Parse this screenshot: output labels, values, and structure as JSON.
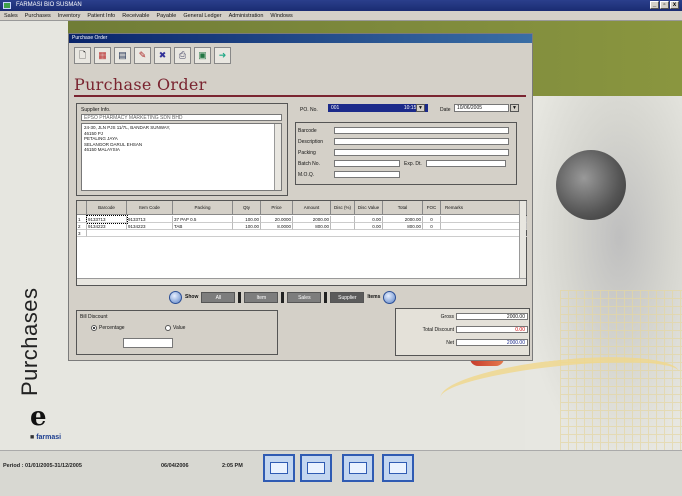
{
  "app": {
    "title": "FARMASI BIO SUSMAN"
  },
  "window_controls": [
    "_",
    "▫",
    "x"
  ],
  "menu": [
    "Sales",
    "Purchases",
    "Inventory",
    "Patient Info",
    "Receivable",
    "Payable",
    "General Ledger",
    "Administration",
    "Windows"
  ],
  "window": {
    "title": "Purchase Order"
  },
  "toolbar": [
    "new-icon",
    "open-icon",
    "save-icon",
    "edit-icon",
    "delete-icon",
    "print-icon",
    "preview-icon",
    "exit-icon"
  ],
  "page_title": "Purchase Order",
  "supplier": {
    "label": "Supplier Info.",
    "selected": "EPSO PHARMACY MARKETING SDN BHD",
    "address": [
      "24-30, JLN PJS 11/7L, BANDAR SUNWAY,",
      "46150 PJ",
      "PETALING JAYA",
      "SELANGOR DARUL EHSAN",
      "46150 MALAYSIA"
    ]
  },
  "po": {
    "label": "PO. No.",
    "number": "001",
    "time": "10:15 AM",
    "date_label": "Date",
    "date": "10/06/2005"
  },
  "details": {
    "barcode_label": "Barcode",
    "description_label": "Description",
    "packing_label": "Packing",
    "batch_label": "Batch No.",
    "exp_label": "Exp. Dt.",
    "moq_label": "M.O.Q."
  },
  "grid": {
    "headers": [
      "Barcode",
      "Item Code",
      "Packing",
      "Qty",
      "Price",
      "Amount",
      "Disc (%)",
      "Disc Value",
      "Total",
      "FOC",
      "Remarks"
    ],
    "rows": [
      {
        "no": "1",
        "barcode": "9133713",
        "code": "9133713",
        "packing": "37 PAP 0.5",
        "qty": "100.00",
        "price": "20.0000",
        "amount": "2000.00",
        "disc": "",
        "disc_value": "0.00",
        "total": "2000.00",
        "foc": "0",
        "remarks": ""
      },
      {
        "no": "2",
        "barcode": "9134223",
        "code": "9134223",
        "packing": "TAB",
        "qty": "100.00",
        "price": "8.0000",
        "amount": "800.00",
        "disc": "",
        "disc_value": "0.00",
        "total": "800.00",
        "foc": "0",
        "remarks": ""
      },
      {
        "no": "3",
        "barcode": "",
        "code": "",
        "packing": "",
        "qty": "",
        "price": "",
        "amount": "",
        "disc": "",
        "disc_value": "",
        "total": "",
        "foc": "",
        "remarks": ""
      }
    ]
  },
  "nav": {
    "show_label": "Show",
    "buttons": [
      "All",
      "Item",
      "Sales",
      "Supplier"
    ],
    "items_label": "Items"
  },
  "discount": {
    "label": "Bill Discount",
    "option_percentage": "Percentage",
    "option_value": "Value",
    "value": ""
  },
  "totals": {
    "gross_label": "Gross",
    "gross": "2000.00",
    "total_discount_label": "Total Discount",
    "total_discount": "0.00",
    "net_label": "Net",
    "net": "2000.00"
  },
  "left_panel": {
    "section": "Purchases",
    "logo_letter": "e",
    "brand": "farmasi"
  },
  "status": {
    "period": "Period : 01/01/2005-31/12/2005",
    "date": "06/04/2006",
    "time": "2:05 PM"
  },
  "colors": {
    "accent": "#7a2430",
    "titlebar": "#1a2c72",
    "olive": "#7e8a3c"
  }
}
